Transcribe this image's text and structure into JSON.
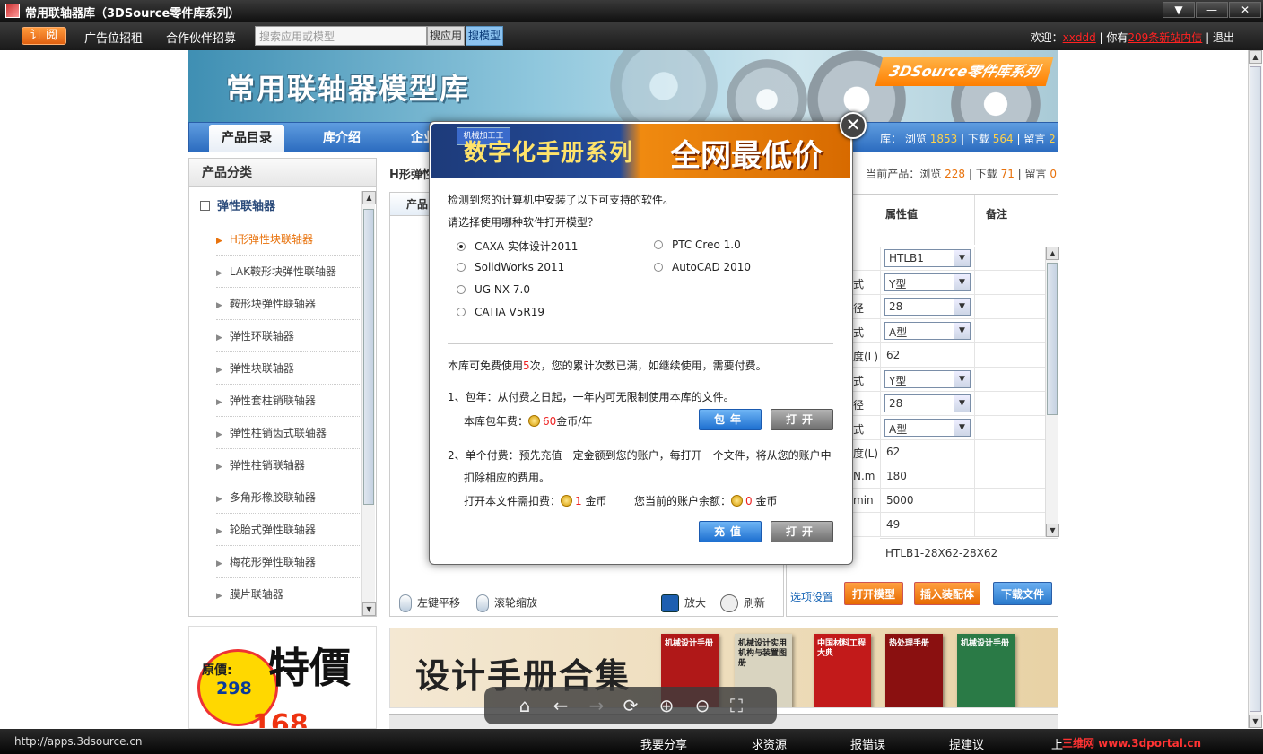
{
  "window": {
    "title": "常用联轴器库（3DSource零件库系列）",
    "controls": [
      "▼",
      "—",
      "✕"
    ]
  },
  "topbar": {
    "subscribe": "订 阅",
    "links": [
      "广告位招租",
      "合作伙伴招募"
    ],
    "search_placeholder": "搜索应用或模型",
    "search_app": "搜应用",
    "search_model": "搜模型",
    "welcome_prefix": "欢迎：",
    "username": "xxddd",
    "sep1": "| 你有",
    "messages": "209条新站内信",
    "sep2": "| 退出"
  },
  "banner": {
    "title": "常用联轴器模型库",
    "brand": "3DSource零件库系列"
  },
  "nav": {
    "tabs": [
      "产品目录",
      "库介绍",
      "企业"
    ],
    "stats": {
      "prefix": "库：",
      "view_label": "浏览",
      "views": "1853",
      "dl_label": "| 下载",
      "downloads": "564",
      "msg_label": "| 留言",
      "messages": "2"
    }
  },
  "sidebar": {
    "heading": "产品分类",
    "category": "弹性联轴器",
    "items": [
      "H形弹性块联轴器",
      "LAK鞍形块弹性联轴器",
      "鞍形块弹性联轴器",
      "弹性环联轴器",
      "弹性块联轴器",
      "弹性套柱销联轴器",
      "弹性柱销齿式联轴器",
      "弹性柱销联轴器",
      "多角形橡胶联轴器",
      "轮胎式弹性联轴器",
      "梅花形弹性联轴器",
      "膜片联轴器"
    ]
  },
  "promo": {
    "original_label": "原價:",
    "original_price": "298",
    "special": "特價",
    "price": "168"
  },
  "main": {
    "title": "H形弹性",
    "current": {
      "prefix": "当前产品：浏览",
      "views": "228",
      "dl_label": "| 下载",
      "downloads": "71",
      "msg_label": "| 留言",
      "messages": "0"
    },
    "viewer_tab": "产品",
    "tools": {
      "pan": "左键平移",
      "zoom_wheel": "滚轮缩放",
      "enlarge": "放大",
      "refresh": "刷新"
    }
  },
  "params": {
    "header_value": "属性值",
    "header_note": "备注",
    "rows": [
      {
        "label": "",
        "value": "HTLB1",
        "select": true
      },
      {
        "label": "式",
        "value": "Y型",
        "select": true
      },
      {
        "label": "径",
        "value": "28",
        "select": true
      },
      {
        "label": "式",
        "value": "A型",
        "select": true
      },
      {
        "label": "度(L)",
        "value": "62",
        "select": false
      },
      {
        "label": "式",
        "value": "Y型",
        "select": true
      },
      {
        "label": "径",
        "value": "28",
        "select": true
      },
      {
        "label": "式",
        "value": "A型",
        "select": true
      },
      {
        "label": "度(L)",
        "value": "62",
        "select": false
      },
      {
        "label": "N.m",
        "value": "180",
        "select": false
      },
      {
        "label": "min",
        "value": "5000",
        "select": false
      },
      {
        "label": "",
        "value": "49",
        "select": false
      }
    ],
    "part_code": "HTLB1-28X62-28X62",
    "option_link": "选项设置",
    "open_model": "打开模型",
    "insert_assembly": "插入装配体",
    "download": "下载文件"
  },
  "bottom_banner": {
    "title": "设计手册合集",
    "books": [
      "机械设计手册",
      "机械设计实用机构与装置图册",
      "中国材料工程大典",
      "热处理手册",
      "机械设计手册"
    ]
  },
  "modal": {
    "ad_left": "数字化手册系列",
    "ad_right": "全网最低价",
    "ad_book": "机械加工工",
    "close": "✕",
    "detected": "检测到您的计算机中安装了以下可支持的软件。",
    "choose": "请选择使用哪种软件打开模型？",
    "software": [
      "CAXA 实体设计2011",
      "PTC Creo 1.0",
      "SolidWorks 2011",
      "AutoCAD 2010",
      "UG NX 7.0",
      "CATIA V5R19"
    ],
    "selected_index": 0,
    "free_text_1": "本库可免费使用",
    "free_count": "5",
    "free_text_2": "次，您的累计次数已满，如继续使用，需要付费。",
    "opt1": "1、包年：从付费之日起，一年内可无限制使用本库的文件。",
    "annual_label": "本库包年费：",
    "annual_price": "60",
    "annual_unit": "金币/年",
    "btn_annual": "包年",
    "btn_open": "打开",
    "opt2_line1": "2、单个付费：预先充值一定金额到您的账户，每打开一个文件，将从您的账户中",
    "opt2_line2": "扣除相应的费用。",
    "file_cost_label": "打开本文件需扣费：",
    "file_cost": "1",
    "coin_unit": "金币",
    "balance_label": "您当前的账户余额：",
    "balance": "0",
    "btn_recharge": "充值",
    "btn_open2": "打开"
  },
  "statusbar": {
    "url": "http://apps.3dsource.cn",
    "links": [
      "我要分享",
      "求资源",
      "报错误",
      "提建议",
      "上"
    ],
    "watermark": "三维网 www.3dportal.cn"
  },
  "floatbar": {
    "icons": [
      "home-icon",
      "back-icon",
      "forward-icon",
      "refresh-icon",
      "zoom-in-icon",
      "zoom-out-icon",
      "fit-icon"
    ]
  }
}
